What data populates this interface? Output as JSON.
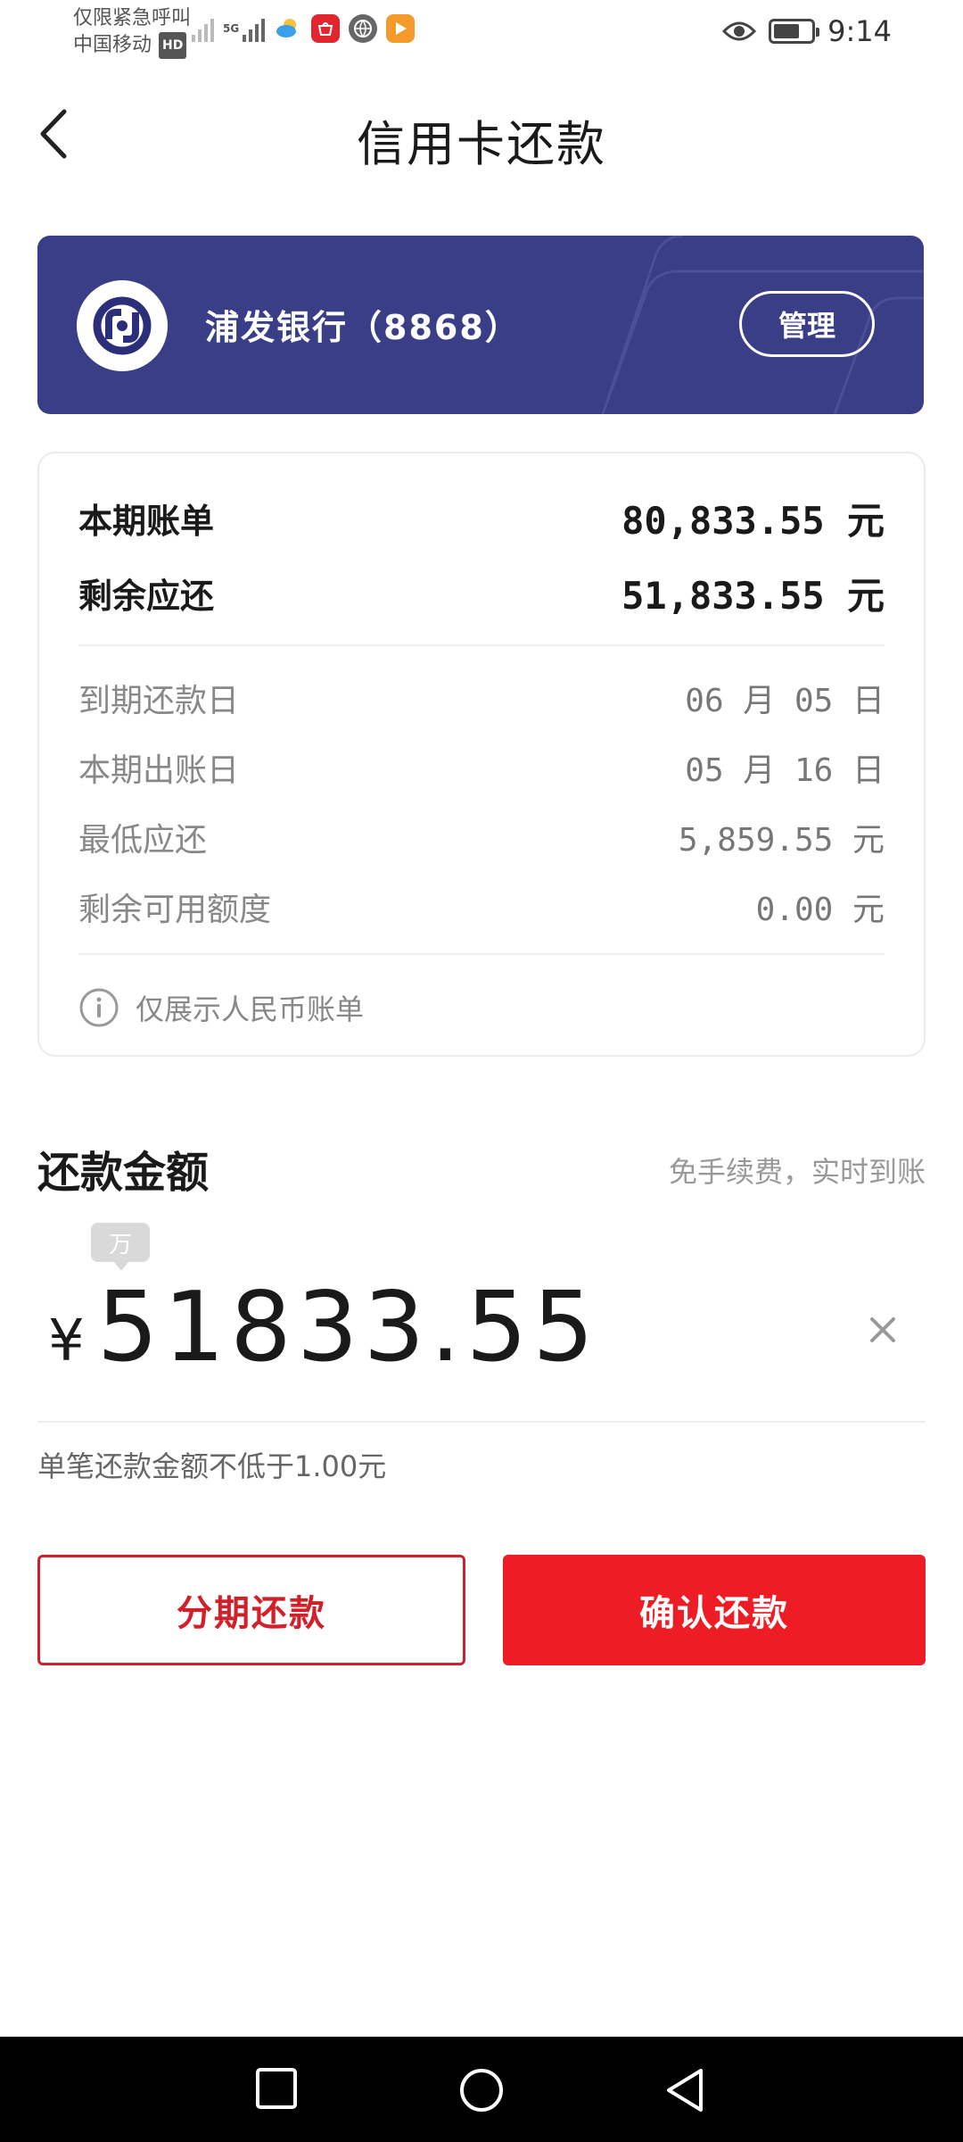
{
  "status_bar": {
    "line1": "仅限紧急呼叫",
    "line2": "中国移动",
    "hd": "HD",
    "network": "5G",
    "time": "9:14",
    "colors": {
      "weather": "#3aa0e8",
      "huawei": "#e2262f",
      "browser": "#666666",
      "video": "#f39a2b"
    }
  },
  "header": {
    "title": "信用卡还款"
  },
  "bank_card": {
    "name": "浦发银行（8868）",
    "manage_label": "管理",
    "bg_color": "#3a3e87"
  },
  "bill": {
    "current_bill_label": "本期账单",
    "current_bill_value": "80,833.55 元",
    "remaining_label": "剩余应还",
    "remaining_value": "51,833.55 元",
    "due_date_label": "到期还款日",
    "due_date_value": "06 月 05 日",
    "statement_date_label": "本期出账日",
    "statement_date_value": "05 月 16 日",
    "min_payment_label": "最低应还",
    "min_payment_value": "5,859.55 元",
    "available_credit_label": "剩余可用额度",
    "available_credit_value": "0.00 元",
    "note": "仅展示人民币账单"
  },
  "repay": {
    "title": "还款金额",
    "hint": "免手续费，实时到账",
    "unit_tip": "万",
    "currency": "¥",
    "amount": "51833.55",
    "min_hint": "单笔还款金额不低于1.00元"
  },
  "buttons": {
    "installment": "分期还款",
    "confirm": "确认还款",
    "accent_color": "#ee1c25"
  }
}
